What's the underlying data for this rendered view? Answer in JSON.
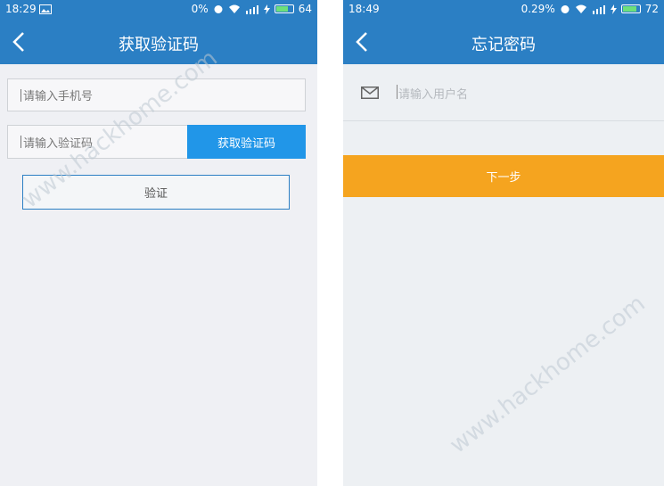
{
  "left_screen": {
    "status": {
      "time": "18:29",
      "battery_text": "0%",
      "battery_level": "64"
    },
    "title": "获取验证码",
    "phone_placeholder": "请输入手机号",
    "code_placeholder": "请输入验证码",
    "get_code_label": "获取验证码",
    "verify_label": "验证"
  },
  "right_screen": {
    "status": {
      "time": "18:49",
      "battery_text": "0.29%",
      "battery_level": "72"
    },
    "title": "忘记密码",
    "username_placeholder": "请输入用户名",
    "next_label": "下一步"
  },
  "watermark": "www.hackhome.com",
  "colors": {
    "header": "#2b7fc4",
    "blue_button": "#2196e8",
    "orange_button": "#f5a41f"
  },
  "icons": [
    "back-icon",
    "picture-icon",
    "alarm-icon",
    "wifi-icon",
    "signal-icon",
    "charging-icon",
    "battery-icon",
    "mail-icon"
  ]
}
